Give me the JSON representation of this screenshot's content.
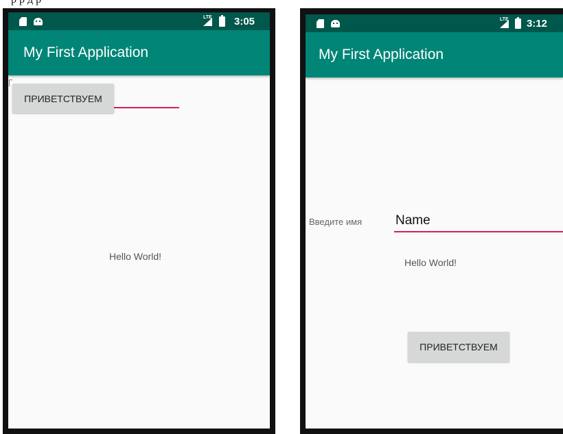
{
  "caption": "р                 р д   р",
  "left": {
    "status": {
      "sd_icon": "sd-card-icon",
      "notify_icon": "android-icon",
      "network": "LTE",
      "time": "3:05"
    },
    "app_title": "My First Application",
    "button_label": "ПРИВЕТСТВУЕМ",
    "hello": "Hello World!",
    "colors": {
      "status": "#00574b",
      "appbar": "#008577",
      "accent": "#d81b60"
    }
  },
  "right": {
    "status": {
      "sd_icon": "sd-card-icon",
      "notify_icon": "android-icon",
      "network": "LTE",
      "time": "3:12"
    },
    "app_title": "My First Application",
    "label": "Введите имя",
    "name_value": "Name",
    "hello": "Hello World!",
    "button_label": "ПРИВЕТСТВУЕМ"
  }
}
